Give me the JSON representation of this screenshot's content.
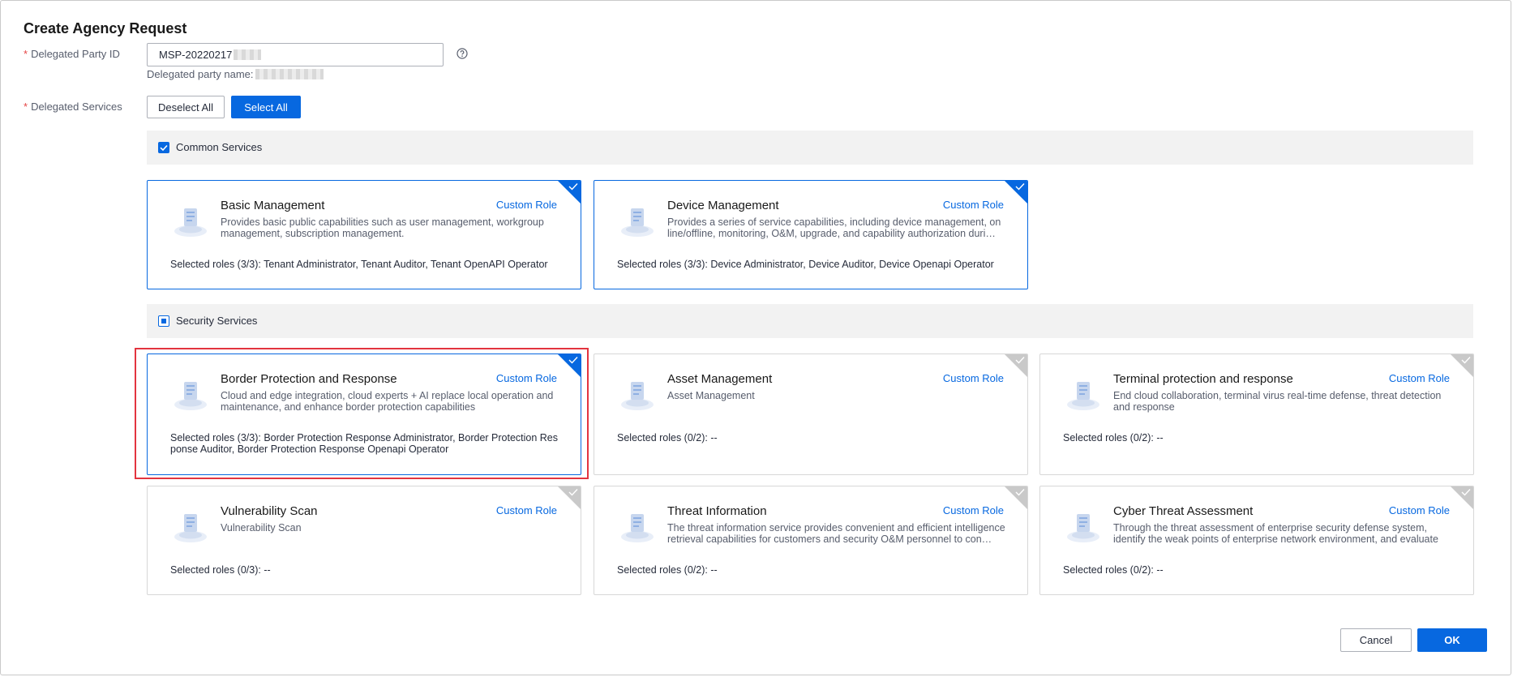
{
  "dialog": {
    "title": "Create Agency Request"
  },
  "party": {
    "label": "Delegated Party ID",
    "value": "MSP-20220217",
    "name_label": "Delegated party name:"
  },
  "services": {
    "label": "Delegated Services",
    "deselect_all": "Deselect All",
    "select_all": "Select All"
  },
  "groups": [
    {
      "label": "Common Services",
      "state": "checked"
    },
    {
      "label": "Security Services",
      "state": "partial"
    }
  ],
  "cards": [
    {
      "name": "Basic Management",
      "custom": "Custom Role",
      "desc": "Provides basic public capabilities such as user management, workgroup management, subscription management.",
      "roles": "Selected roles (3/3): Tenant Administrator, Tenant Auditor, Tenant OpenAPI Operator",
      "selected": true,
      "icon": "document-icon"
    },
    {
      "name": "Device Management",
      "custom": "Custom Role",
      "desc": "Provides a series of service capabilities, including device management, on line/offline, monitoring, O&M, upgrade, and capability authorization duri…",
      "roles": "Selected roles (3/3): Device Administrator, Device Auditor, Device Openapi Operator",
      "selected": true,
      "icon": "device-icon"
    },
    {
      "name": "Border Protection and Response",
      "custom": "Custom Role",
      "desc": "Cloud and edge integration, cloud experts + AI replace local operation and maintenance, and enhance border protection capabilities",
      "roles": "Selected roles (3/3): Border Protection Response Administrator, Border Protection Response Auditor, Border Protection Response Openapi Operator",
      "selected": true,
      "icon": "shield-icon"
    },
    {
      "name": "Asset Management",
      "custom": "Custom Role",
      "desc": "Asset Management",
      "roles": "Selected roles (0/2): --",
      "selected": false,
      "icon": "server-icon"
    },
    {
      "name": "Terminal protection and response",
      "custom": "Custom Role",
      "desc": "End cloud collaboration, terminal virus real-time defense, threat detection and response",
      "roles": "Selected roles (0/2): --",
      "selected": false,
      "icon": "terminal-icon"
    },
    {
      "name": "Vulnerability Scan",
      "custom": "Custom Role",
      "desc": "Vulnerability Scan",
      "roles": "Selected roles (0/3): --",
      "selected": false,
      "icon": "scan-icon"
    },
    {
      "name": "Threat Information",
      "custom": "Custom Role",
      "desc": "The threat information service provides convenient and efficient intelligence retrieval capabilities for customers and security O&M personnel to con…",
      "roles": "Selected roles (0/2): --",
      "selected": false,
      "icon": "globe-icon"
    },
    {
      "name": "Cyber Threat Assessment",
      "custom": "Custom Role",
      "desc": "Through the threat assessment of enterprise security defense system, identify the weak points of enterprise network environment, and evaluate th…",
      "roles": "Selected roles (0/2): --",
      "selected": false,
      "icon": "assessment-icon"
    }
  ],
  "footer": {
    "cancel": "Cancel",
    "ok": "OK"
  },
  "colors": {
    "primary": "#0768e0",
    "highlight": "#e3343f",
    "required": "#e54545"
  }
}
